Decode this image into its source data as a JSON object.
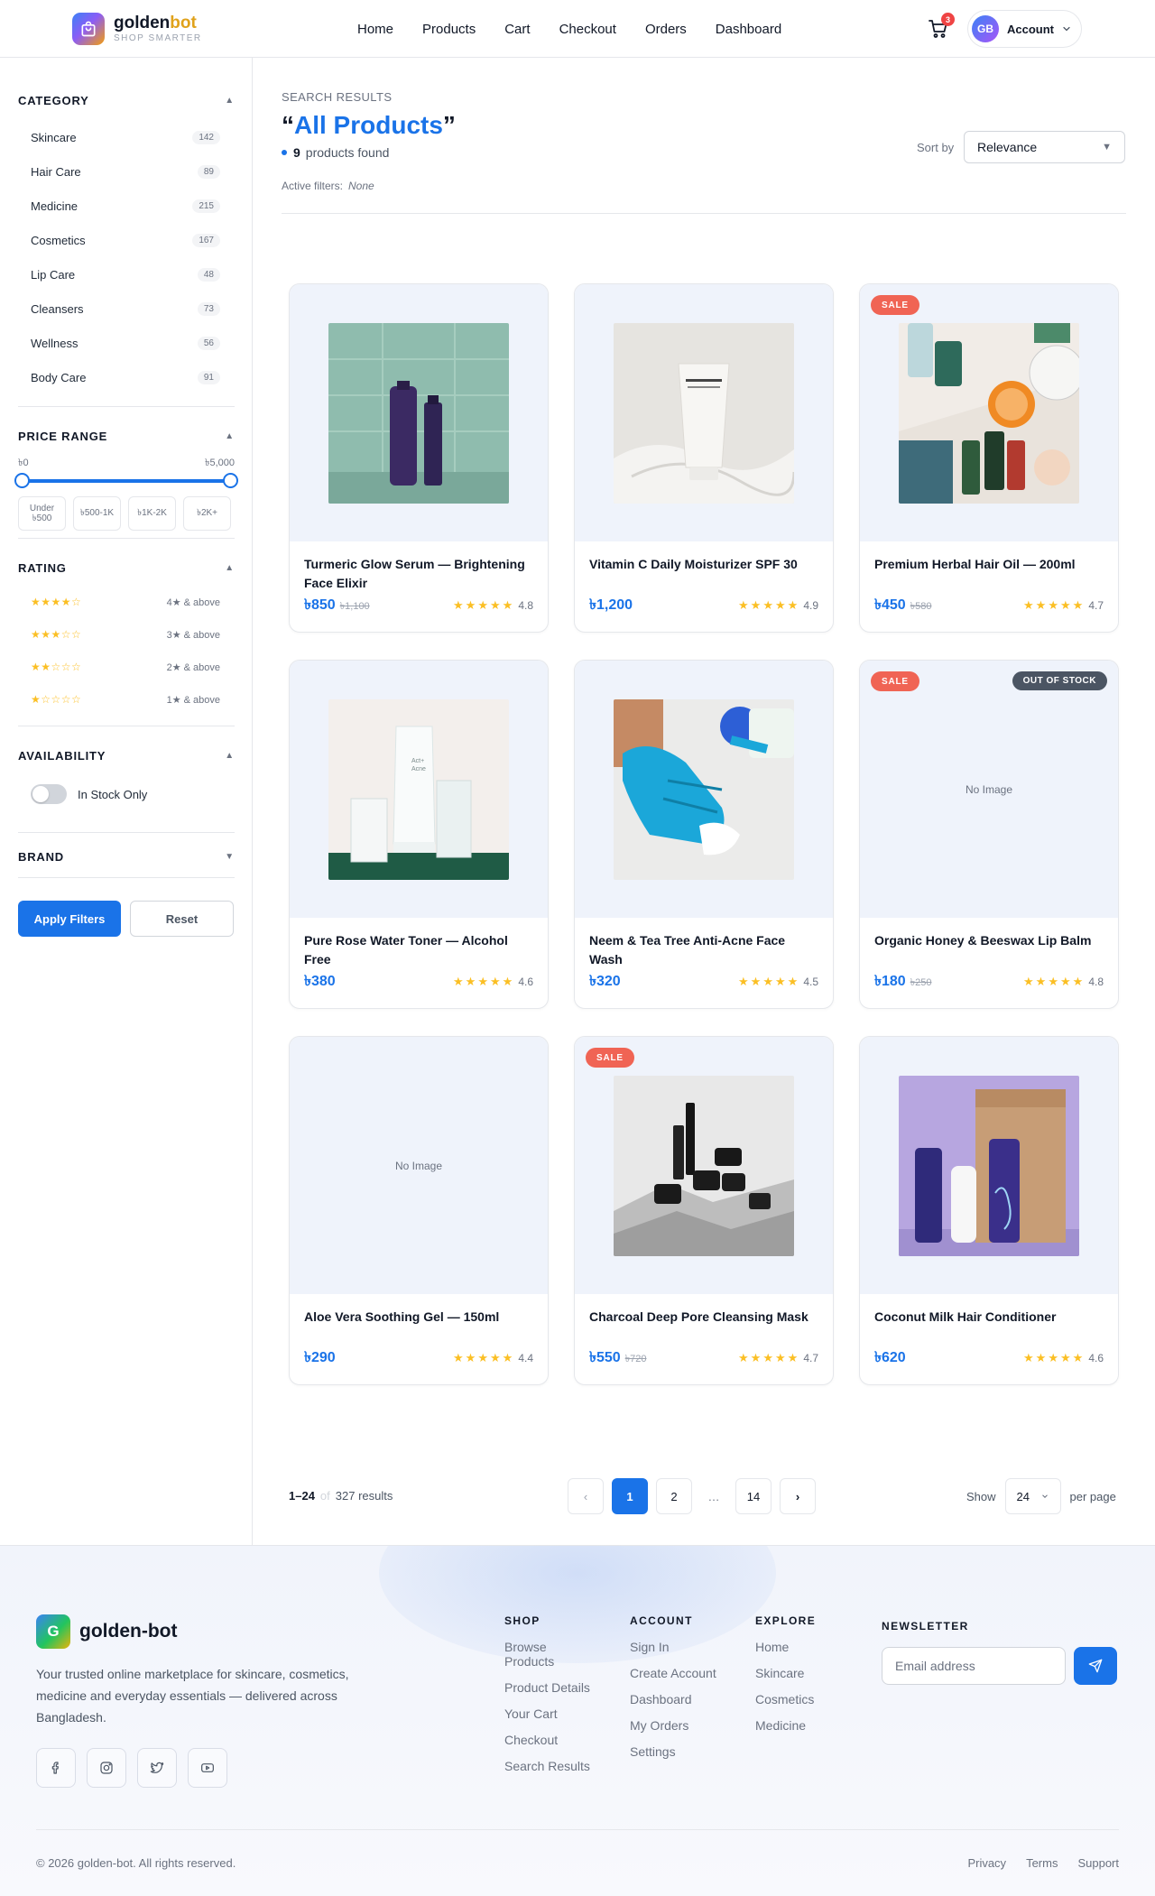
{
  "header": {
    "brand": {
      "name_main": "golden",
      "name_accent": "bot",
      "tagline": "SHOP SMARTER"
    },
    "nav": [
      "Home",
      "Products",
      "Cart",
      "Checkout",
      "Orders",
      "Dashboard"
    ],
    "cart_count": "3",
    "account": {
      "initials": "GB",
      "label": "Account"
    }
  },
  "sidebar": {
    "category": {
      "title": "CATEGORY",
      "items": [
        {
          "label": "Skincare",
          "count": "142"
        },
        {
          "label": "Hair Care",
          "count": "89"
        },
        {
          "label": "Medicine",
          "count": "215"
        },
        {
          "label": "Cosmetics",
          "count": "167"
        },
        {
          "label": "Lip Care",
          "count": "48"
        },
        {
          "label": "Cleansers",
          "count": "73"
        },
        {
          "label": "Wellness",
          "count": "56"
        },
        {
          "label": "Body Care",
          "count": "91"
        }
      ]
    },
    "price": {
      "title": "PRICE RANGE",
      "min_label": "৳0",
      "max_label": "৳5,000",
      "chips": [
        "Under ৳500",
        "৳500-1K",
        "৳1K-2K",
        "৳2K+"
      ]
    },
    "rating": {
      "title": "RATING",
      "items": [
        {
          "stars": "★★★★☆",
          "label": "4★ & above"
        },
        {
          "stars": "★★★☆☆",
          "label": "3★ & above"
        },
        {
          "stars": "★★☆☆☆",
          "label": "2★ & above"
        },
        {
          "stars": "★☆☆☆☆",
          "label": "1★ & above"
        }
      ]
    },
    "availability": {
      "title": "AVAILABILITY",
      "toggle_label": "In Stock Only",
      "toggle_on": false
    },
    "brand": {
      "title": "BRAND"
    },
    "apply_label": "Apply Filters",
    "reset_label": "Reset"
  },
  "results": {
    "kicker": "SEARCH RESULTS",
    "open_quote": "“",
    "title": "All Products",
    "close_quote": "”",
    "count": "9",
    "count_label": "products found",
    "active_filters_label": "Active filters:",
    "active_filters_value": "None",
    "sort_label": "Sort by",
    "sort_value": "Relevance"
  },
  "products": [
    {
      "name": "Turmeric Glow Serum — Brightening Face Elixir",
      "price": "৳850",
      "old_price": "৳1,100",
      "stars": "★★★★★",
      "rating": "4.8",
      "image": "tubes-teal",
      "sale": "",
      "oos": ""
    },
    {
      "name": "Vitamin C Daily Moisturizer SPF 30",
      "price": "৳1,200",
      "old_price": "",
      "stars": "★★★★★",
      "rating": "4.9",
      "image": "white-tube",
      "sale": "",
      "oos": ""
    },
    {
      "name": "Premium Herbal Hair Oil — 200ml",
      "price": "৳450",
      "old_price": "৳580",
      "stars": "★★★★★",
      "rating": "4.7",
      "image": "flatlay",
      "sale": "SALE",
      "oos": ""
    },
    {
      "name": "Pure Rose Water Toner — Alcohol Free",
      "price": "৳380",
      "old_price": "",
      "stars": "★★★★★",
      "rating": "4.6",
      "image": "acne-tube",
      "sale": "",
      "oos": ""
    },
    {
      "name": "Neem & Tea Tree Anti-Acne Face Wash",
      "price": "৳320",
      "old_price": "",
      "stars": "★★★★★",
      "rating": "4.5",
      "image": "glove",
      "sale": "",
      "oos": ""
    },
    {
      "name": "Organic Honey & Beeswax Lip Balm",
      "price": "৳180",
      "old_price": "৳250",
      "stars": "★★★★★",
      "rating": "4.8",
      "image": "",
      "no_image": "No Image",
      "sale": "SALE",
      "oos": "OUT OF STOCK"
    },
    {
      "name": "Aloe Vera Soothing Gel — 150ml",
      "price": "৳290",
      "old_price": "",
      "stars": "★★★★★",
      "rating": "4.4",
      "image": "",
      "no_image": "No Image",
      "sale": "",
      "oos": ""
    },
    {
      "name": "Charcoal Deep Pore Cleansing Mask",
      "price": "৳550",
      "old_price": "৳720",
      "stars": "★★★★★",
      "rating": "4.7",
      "image": "jars",
      "sale": "SALE",
      "oos": ""
    },
    {
      "name": "Coconut Milk Hair Conditioner",
      "price": "৳620",
      "old_price": "",
      "stars": "★★★★★",
      "rating": "4.6",
      "image": "box-purple",
      "sale": "",
      "oos": ""
    }
  ],
  "pagination": {
    "range": "1–24",
    "of": "of",
    "total": "327 results",
    "prev": "‹",
    "pages": [
      "1",
      "2",
      "…",
      "14"
    ],
    "next": "›",
    "show_label": "Show",
    "per_page_value": "24",
    "per_page_label": "per page"
  },
  "footer": {
    "logo_letter": "G",
    "name": "golden-bot",
    "description": "Your trusted online marketplace for skincare, cosmetics, medicine and everyday essentials — delivered across Bangladesh.",
    "socials": [
      "facebook-icon",
      "instagram-icon",
      "twitter-icon",
      "youtube-icon"
    ],
    "columns": [
      {
        "title": "SHOP",
        "links": [
          "Browse Products",
          "Product Details",
          "Your Cart",
          "Checkout",
          "Search Results"
        ]
      },
      {
        "title": "ACCOUNT",
        "links": [
          "Sign In",
          "Create Account",
          "Dashboard",
          "My Orders",
          "Settings"
        ]
      },
      {
        "title": "EXPLORE",
        "links": [
          "Home",
          "Skincare",
          "Cosmetics",
          "Medicine"
        ]
      }
    ],
    "newsletter": {
      "title": "NEWSLETTER",
      "placeholder": "Email address"
    },
    "copyright": "© 2026 golden-bot. All rights reserved.",
    "legal": [
      "Privacy",
      "Terms",
      "Support"
    ]
  },
  "colors": {
    "accent": "#1a73e8",
    "sale": "#f06454",
    "star": "#fbbf24",
    "oos": "#4b5563"
  }
}
